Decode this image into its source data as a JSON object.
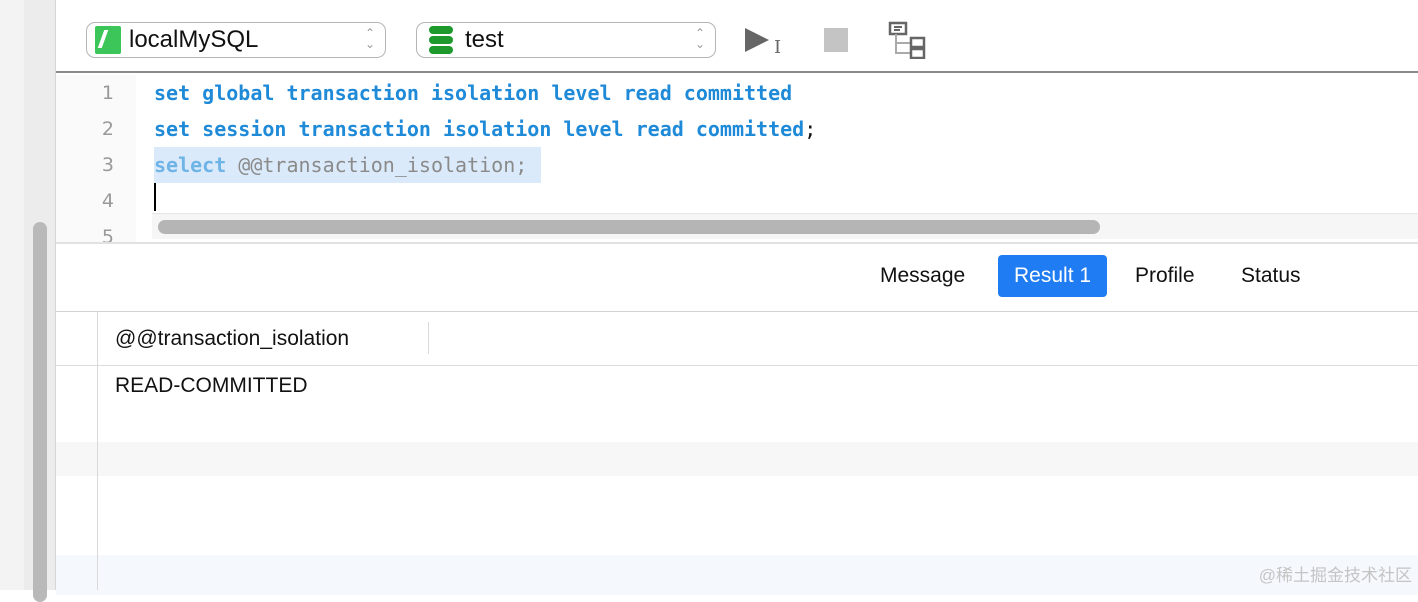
{
  "toolbar": {
    "connection": "localMySQL",
    "database": "test",
    "icons": [
      "mysql-icon",
      "database-icon",
      "run-selected-icon",
      "stop-icon",
      "explain-icon"
    ]
  },
  "editor": {
    "lines": [
      {
        "num": "1",
        "kw": "set global transaction isolation level read committed",
        "rest": ""
      },
      {
        "num": "2",
        "kw": "set session transaction isolation level read committed",
        "rest": ";"
      },
      {
        "num": "3",
        "kw": "select",
        "rest": " @@transaction_isolation;"
      },
      {
        "num": "4",
        "kw": "",
        "rest": ""
      },
      {
        "num": "5",
        "kw": "",
        "rest": ""
      }
    ]
  },
  "results": {
    "tabs": [
      "Message",
      "Result 1",
      "Profile",
      "Status"
    ],
    "active_tab": "Result 1",
    "columns": [
      "@@transaction_isolation"
    ],
    "rows": [
      [
        "READ-COMMITTED"
      ]
    ]
  },
  "watermark": "@稀土掘金技术社区",
  "colors": {
    "keyword": "#1e8ad8",
    "accent": "#1f7cf2",
    "selection": "#dbeafa"
  }
}
